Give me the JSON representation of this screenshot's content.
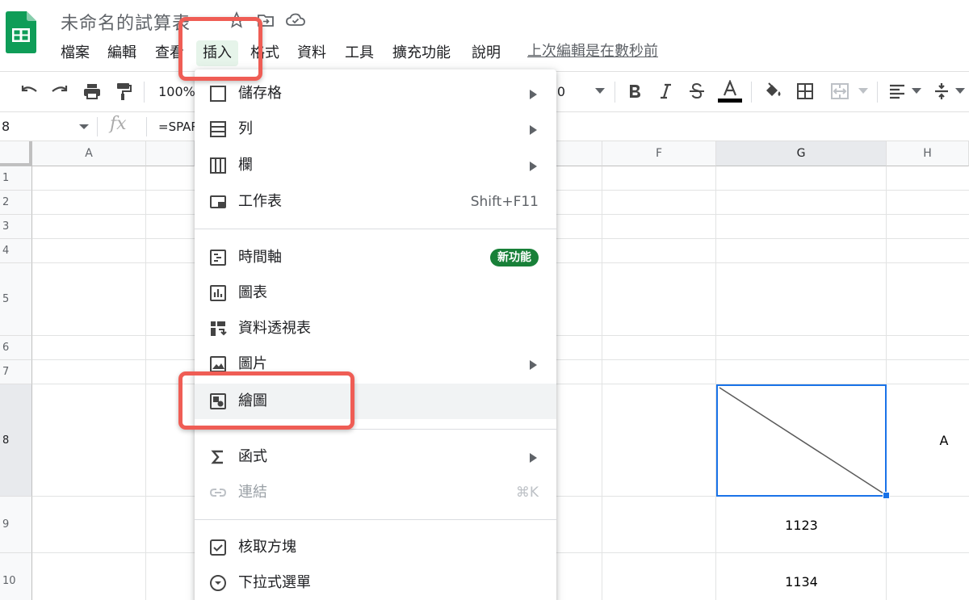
{
  "app": {
    "doc_title": "未命名的試算表",
    "brand_color": "#0f9d58",
    "highlight_color": "#ef5d55"
  },
  "menubar": {
    "items": [
      {
        "label": "檔案"
      },
      {
        "label": "編輯"
      },
      {
        "label": "查看"
      },
      {
        "label": "插入",
        "active": true
      },
      {
        "label": "格式"
      },
      {
        "label": "資料"
      },
      {
        "label": "工具"
      },
      {
        "label": "擴充功能"
      },
      {
        "label": "說明"
      }
    ],
    "last_edit": "上次編輯是在數秒前"
  },
  "toolbar": {
    "zoom": "100%",
    "font_size": "0"
  },
  "formula_bar": {
    "namebox": "8",
    "fx": "fx",
    "formula": "=SPAR"
  },
  "grid": {
    "columns": [
      "A",
      "F",
      "G",
      "H"
    ],
    "rows": [
      "1",
      "2",
      "3",
      "4",
      "5",
      "6",
      "7",
      "8",
      "9",
      "10"
    ],
    "cells": {
      "H8": "A",
      "G9": "1123",
      "G10": "1134"
    }
  },
  "insert_menu": {
    "items": [
      {
        "label": "儲存格",
        "icon": "cell-icon",
        "submenu": true
      },
      {
        "label": "列",
        "icon": "row-icon",
        "submenu": true
      },
      {
        "label": "欄",
        "icon": "column-icon",
        "submenu": true
      },
      {
        "label": "工作表",
        "icon": "sheet-icon",
        "shortcut": "Shift+F11"
      },
      {
        "label": "時間軸",
        "icon": "timeline-icon",
        "badge": "新功能"
      },
      {
        "label": "圖表",
        "icon": "chart-icon"
      },
      {
        "label": "資料透視表",
        "icon": "pivot-table-icon"
      },
      {
        "label": "圖片",
        "icon": "image-icon",
        "submenu": true
      },
      {
        "label": "繪圖",
        "icon": "drawing-icon",
        "highlighted": true
      },
      {
        "label": "函式",
        "icon": "sigma-icon",
        "submenu": true
      },
      {
        "label": "連結",
        "icon": "link-icon",
        "shortcut": "⌘K",
        "disabled": true
      },
      {
        "label": "核取方塊",
        "icon": "checkbox-icon"
      },
      {
        "label": "下拉式選單",
        "icon": "dropdown-icon"
      }
    ]
  }
}
